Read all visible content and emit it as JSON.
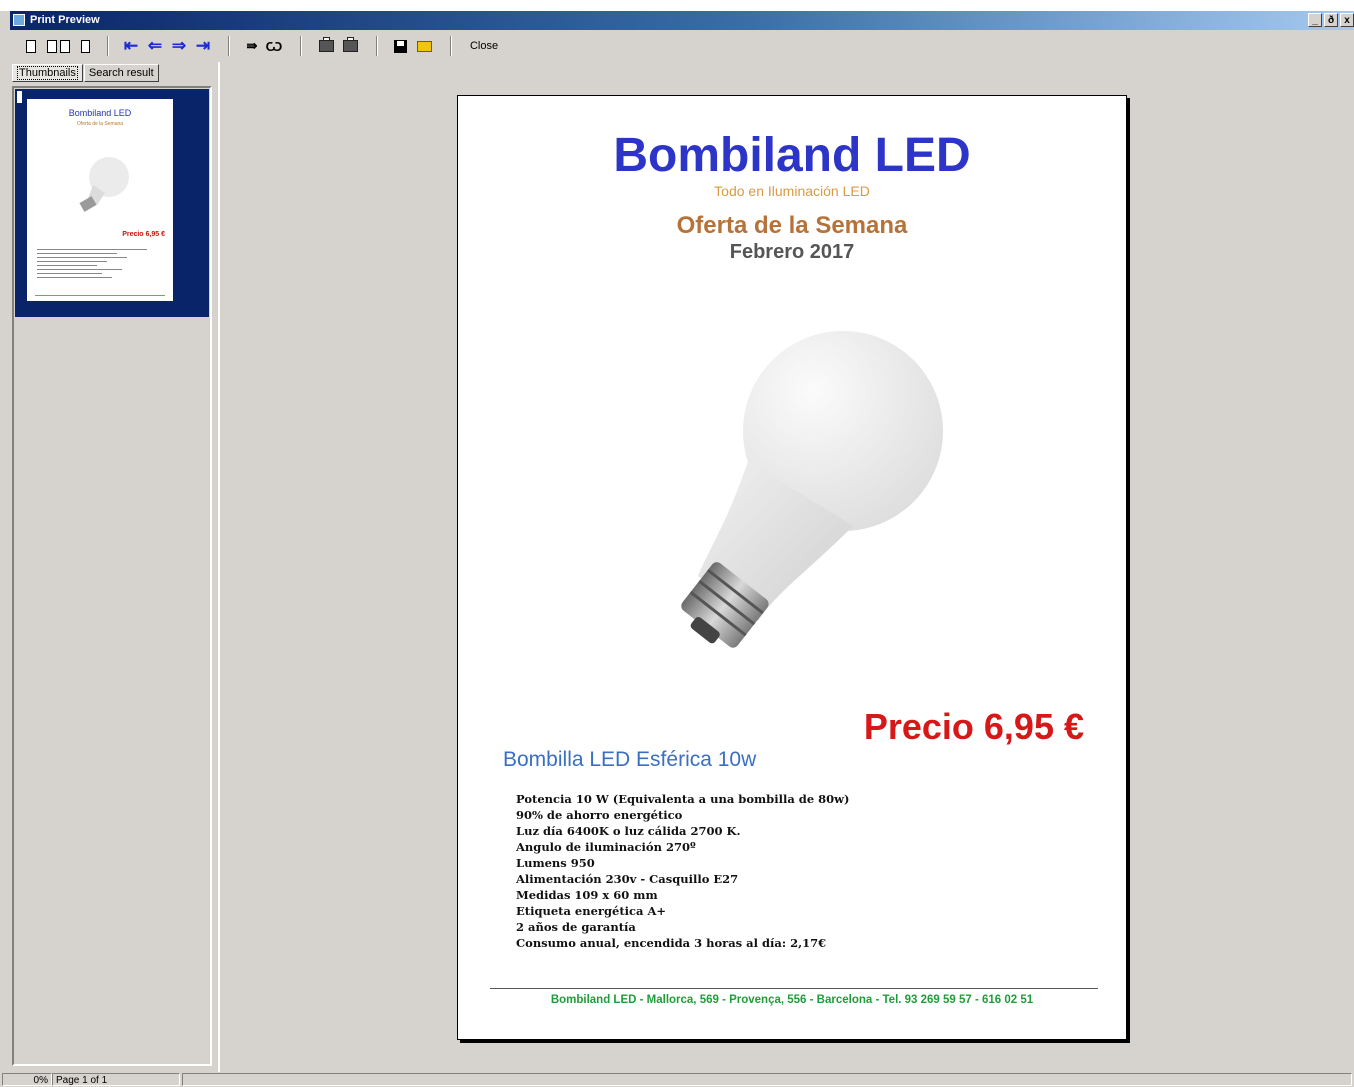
{
  "window": {
    "title": "Print Preview",
    "controls": {
      "minimize": "_",
      "restore": "ð",
      "close": "x"
    }
  },
  "toolbar": {
    "close_label": "Close"
  },
  "tabs": [
    {
      "label": "Thumbnails"
    },
    {
      "label": "Search result"
    }
  ],
  "thumbnail": {
    "brand": "Bombiland LED",
    "price": "Precio 6,95 €"
  },
  "page": {
    "brand": "Bombiland LED",
    "tagline": "Todo en Iluminación LED",
    "offer": "Oferta de la Semana",
    "date": "Febrero 2017",
    "price": "Precio 6,95 €",
    "product": "Bombilla LED Esférica 10w",
    "specs": [
      "Potencia 10 W (Equivalenta a una bombilla de 80w)",
      "90% de ahorro energético",
      "Luz día 6400K o luz cálida 2700 K.",
      "Angulo de iluminación 270º",
      "Lumens 950",
      "Alimentación 230v - Casquillo E27",
      "Medidas 109 x 60 mm",
      "Etiqueta energética A+",
      "2 años de garantía",
      "Consumo anual, encendida 3 horas al día: 2,17€"
    ],
    "footer": "Bombiland LED - Mallorca, 569 - Provença, 556 - Barcelona   -   Tel. 93 269 59 57 - 616 02 51"
  },
  "status": {
    "zoom": "0%",
    "page_info": "Page 1 of 1"
  },
  "colors": {
    "brand_blue": "#2c35c8",
    "price_red": "#d61818",
    "footer_green": "#1e9e3a",
    "selection_navy": "#0a246a"
  }
}
